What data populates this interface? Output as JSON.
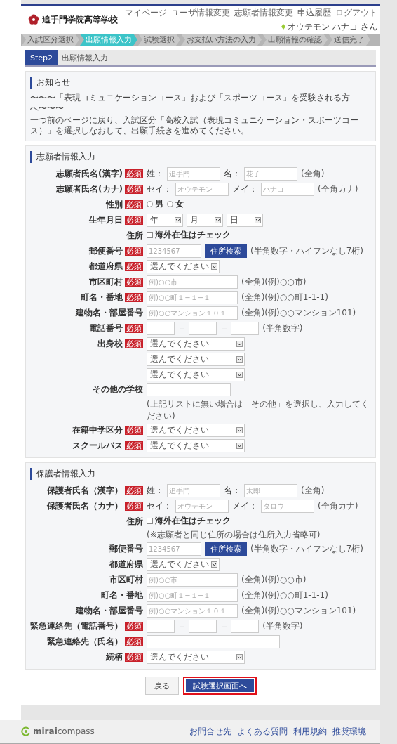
{
  "header": {
    "school_name": "追手門学院高等学校",
    "nav": [
      "マイページ",
      "ユーザ情報変更",
      "志願者情報変更",
      "申込履歴",
      "ログアウト"
    ],
    "user": "オウテモン ハナコ さん"
  },
  "steps": [
    {
      "label": "入試区分選択",
      "selected": false
    },
    {
      "label": "出願情報入力",
      "selected": true
    },
    {
      "label": "試験選択",
      "selected": false
    },
    {
      "label": "お支払い方法の入力",
      "selected": false
    },
    {
      "label": "出願情報の確認",
      "selected": false
    },
    {
      "label": "送信完了",
      "selected": false
    }
  ],
  "page_title": {
    "step": "Step2",
    "title": "出願情報入力"
  },
  "notice": {
    "title": "お知らせ",
    "lines": [
      "〜〜〜「表現コミュニケーションコース」および「スポーツコース」を受験される方へ〜〜〜",
      "一つ前のページに戻り、入試区分「高校入試（表現コミュニケーション・スポーツコース）」を選択しなおして、出願手続きを進めてください。"
    ]
  },
  "sections": [
    {
      "title": "志願者情報入力",
      "rows": [
        {
          "label": "志願者氏名(漢字)",
          "badge": "必須",
          "controls": [
            {
              "kind": "label",
              "text": "姓："
            },
            {
              "kind": "name-input",
              "placeholder": "追手門"
            },
            {
              "kind": "label",
              "text": "名："
            },
            {
              "kind": "name-input",
              "placeholder": "花子"
            },
            {
              "kind": "hint",
              "text": "(全角)"
            }
          ]
        },
        {
          "label": "志願者氏名(カナ)",
          "badge": "必須",
          "controls": [
            {
              "kind": "label",
              "text": "セイ："
            },
            {
              "kind": "name-input",
              "placeholder": "オウテモン"
            },
            {
              "kind": "label",
              "text": "メイ："
            },
            {
              "kind": "name-input",
              "placeholder": "ハナコ"
            },
            {
              "kind": "hint",
              "text": "(全角カナ)"
            }
          ]
        },
        {
          "label": "性別",
          "badge": "必須",
          "controls": [
            {
              "kind": "radio",
              "label": "男",
              "selected": false
            },
            {
              "kind": "radio",
              "label": "女",
              "selected": false
            }
          ]
        },
        {
          "label": "生年月日",
          "badge": "必須",
          "controls": [
            {
              "kind": "date-select",
              "value": "年"
            },
            {
              "kind": "date-select",
              "value": "月"
            },
            {
              "kind": "date-select",
              "value": "日"
            }
          ]
        },
        {
          "label": "住所",
          "controls": [
            {
              "kind": "checkbox",
              "label": "海外在住はチェック",
              "checked": false
            }
          ]
        },
        {
          "label": "郵便番号",
          "badge": "必須",
          "controls": [
            {
              "kind": "postal-input",
              "placeholder": "1234567"
            },
            {
              "kind": "button",
              "label": "住所検索"
            },
            {
              "kind": "hint",
              "text": "(半角数字・ハイフンなし7桁)"
            }
          ]
        },
        {
          "label": "都道府県",
          "badge": "必須",
          "controls": [
            {
              "kind": "short-select",
              "value": "選んでください"
            }
          ]
        },
        {
          "label": "市区町村",
          "badge": "必須",
          "controls": [
            {
              "kind": "text-input",
              "placeholder": "例)○○市"
            },
            {
              "kind": "hint",
              "text": "(全角)(例)○○市)"
            }
          ]
        },
        {
          "label": "町名・番地",
          "badge": "必須",
          "controls": [
            {
              "kind": "text-input",
              "placeholder": "例)○○町１−１−１"
            },
            {
              "kind": "hint",
              "text": "(全角)(例)○○町1-1-1)"
            }
          ]
        },
        {
          "label": "建物名・部屋番号",
          "controls": [
            {
              "kind": "text-input",
              "placeholder": "例)○○マンション１０１"
            },
            {
              "kind": "hint",
              "text": "(全角)(例)○○マンション101)"
            }
          ]
        },
        {
          "label": "電話番号",
          "badge": "必須",
          "controls": [
            {
              "kind": "phone-input"
            },
            {
              "kind": "label",
              "text": "−"
            },
            {
              "kind": "phone-input"
            },
            {
              "kind": "label",
              "text": "−"
            },
            {
              "kind": "phone-input"
            },
            {
              "kind": "hint",
              "text": "(半角数字)"
            }
          ]
        },
        {
          "label": "出身校",
          "badge": "必須",
          "controls": [
            {
              "kind": "select",
              "value": "選んでください"
            },
            {
              "kind": "select",
              "value": "選んでください"
            },
            {
              "kind": "select",
              "value": "選んでください"
            }
          ]
        },
        {
          "label": "その他の学校",
          "controls": [
            {
              "kind": "school-input"
            },
            {
              "kind": "hint",
              "text": "(上記リストに無い場合は「その他」を選択し、入力してください)"
            }
          ]
        },
        {
          "label": "在籍中学区分",
          "badge": "必須",
          "controls": [
            {
              "kind": "select",
              "value": "選んでください"
            }
          ]
        },
        {
          "label": "スクールバス",
          "badge": "必須",
          "controls": [
            {
              "kind": "select",
              "value": "選んでください"
            }
          ]
        }
      ]
    },
    {
      "title": "保護者情報入力",
      "rows": [
        {
          "label": "保護者氏名（漢字）",
          "badge": "必須",
          "controls": [
            {
              "kind": "label",
              "text": "姓："
            },
            {
              "kind": "name-input",
              "placeholder": "追手門"
            },
            {
              "kind": "label",
              "text": "名："
            },
            {
              "kind": "name-input",
              "placeholder": "太郎"
            },
            {
              "kind": "hint",
              "text": "(全角)"
            }
          ]
        },
        {
          "label": "保護者氏名（カナ）",
          "badge": "必須",
          "controls": [
            {
              "kind": "label",
              "text": "セイ："
            },
            {
              "kind": "name-input",
              "placeholder": "オウテモン"
            },
            {
              "kind": "label",
              "text": "メイ："
            },
            {
              "kind": "name-input",
              "placeholder": "タロウ"
            },
            {
              "kind": "hint",
              "text": "(全角カナ)"
            }
          ]
        },
        {
          "label": "住所",
          "controls": [
            {
              "kind": "checkbox",
              "label": "海外在住はチェック",
              "checked": false
            },
            {
              "kind": "hint",
              "text": "(※志願者と同じ住所の場合は住所入力省略可)"
            }
          ]
        },
        {
          "label": "郵便番号",
          "controls": [
            {
              "kind": "postal-input",
              "placeholder": "1234567"
            },
            {
              "kind": "button",
              "label": "住所検索"
            },
            {
              "kind": "hint",
              "text": "(半角数字・ハイフンなし7桁)"
            }
          ]
        },
        {
          "label": "都道府県",
          "controls": [
            {
              "kind": "short-select",
              "value": "選んでください"
            }
          ]
        },
        {
          "label": "市区町村",
          "controls": [
            {
              "kind": "text-input",
              "placeholder": "例)○○市"
            },
            {
              "kind": "hint",
              "text": "(全角)(例)○○市)"
            }
          ]
        },
        {
          "label": "町名・番地",
          "controls": [
            {
              "kind": "text-input",
              "placeholder": "例)○○町１−１−１"
            },
            {
              "kind": "hint",
              "text": "(全角)(例)○○町1-1-1)"
            }
          ]
        },
        {
          "label": "建物名・部屋番号",
          "controls": [
            {
              "kind": "text-input",
              "placeholder": "例)○○マンション１０１"
            },
            {
              "kind": "hint",
              "text": "(全角)(例)○○マンション101)"
            }
          ]
        },
        {
          "label": "緊急連絡先（電話番号）",
          "badge": "必須",
          "controls": [
            {
              "kind": "phone-input"
            },
            {
              "kind": "label",
              "text": "−"
            },
            {
              "kind": "phone-input"
            },
            {
              "kind": "label",
              "text": "−"
            },
            {
              "kind": "phone-input"
            },
            {
              "kind": "hint",
              "text": "(半角数字)"
            }
          ]
        },
        {
          "label": "緊急連絡先（氏名）",
          "badge": "必須",
          "controls": [
            {
              "kind": "wide-input"
            }
          ]
        },
        {
          "label": "続柄",
          "badge": "必須",
          "controls": [
            {
              "kind": "select",
              "value": "選んでください"
            }
          ]
        }
      ]
    }
  ],
  "actions": [
    {
      "kind": "secondary",
      "label": "戻る",
      "highlighted": false
    },
    {
      "kind": "primary",
      "label": "試験選択画面へ",
      "highlighted": true
    }
  ],
  "footer": {
    "brand": "**mirai**compass",
    "links": [
      "お問合せ先",
      "よくある質問",
      "利用規約",
      "推奨環境"
    ]
  }
}
